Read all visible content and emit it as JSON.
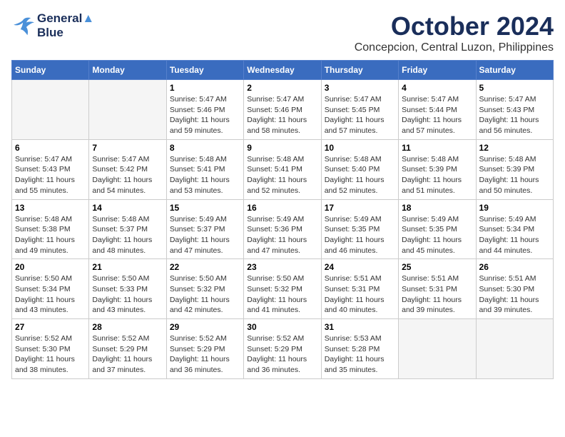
{
  "logo": {
    "line1": "General",
    "line2": "Blue"
  },
  "title": "October 2024",
  "location": "Concepcion, Central Luzon, Philippines",
  "weekdays": [
    "Sunday",
    "Monday",
    "Tuesday",
    "Wednesday",
    "Thursday",
    "Friday",
    "Saturday"
  ],
  "weeks": [
    [
      {
        "day": "",
        "info": ""
      },
      {
        "day": "",
        "info": ""
      },
      {
        "day": "1",
        "sunrise": "5:47 AM",
        "sunset": "5:46 PM",
        "daylight": "11 hours and 59 minutes."
      },
      {
        "day": "2",
        "sunrise": "5:47 AM",
        "sunset": "5:46 PM",
        "daylight": "11 hours and 58 minutes."
      },
      {
        "day": "3",
        "sunrise": "5:47 AM",
        "sunset": "5:45 PM",
        "daylight": "11 hours and 57 minutes."
      },
      {
        "day": "4",
        "sunrise": "5:47 AM",
        "sunset": "5:44 PM",
        "daylight": "11 hours and 57 minutes."
      },
      {
        "day": "5",
        "sunrise": "5:47 AM",
        "sunset": "5:43 PM",
        "daylight": "11 hours and 56 minutes."
      }
    ],
    [
      {
        "day": "6",
        "sunrise": "5:47 AM",
        "sunset": "5:43 PM",
        "daylight": "11 hours and 55 minutes."
      },
      {
        "day": "7",
        "sunrise": "5:47 AM",
        "sunset": "5:42 PM",
        "daylight": "11 hours and 54 minutes."
      },
      {
        "day": "8",
        "sunrise": "5:48 AM",
        "sunset": "5:41 PM",
        "daylight": "11 hours and 53 minutes."
      },
      {
        "day": "9",
        "sunrise": "5:48 AM",
        "sunset": "5:41 PM",
        "daylight": "11 hours and 52 minutes."
      },
      {
        "day": "10",
        "sunrise": "5:48 AM",
        "sunset": "5:40 PM",
        "daylight": "11 hours and 52 minutes."
      },
      {
        "day": "11",
        "sunrise": "5:48 AM",
        "sunset": "5:39 PM",
        "daylight": "11 hours and 51 minutes."
      },
      {
        "day": "12",
        "sunrise": "5:48 AM",
        "sunset": "5:39 PM",
        "daylight": "11 hours and 50 minutes."
      }
    ],
    [
      {
        "day": "13",
        "sunrise": "5:48 AM",
        "sunset": "5:38 PM",
        "daylight": "11 hours and 49 minutes."
      },
      {
        "day": "14",
        "sunrise": "5:48 AM",
        "sunset": "5:37 PM",
        "daylight": "11 hours and 48 minutes."
      },
      {
        "day": "15",
        "sunrise": "5:49 AM",
        "sunset": "5:37 PM",
        "daylight": "11 hours and 47 minutes."
      },
      {
        "day": "16",
        "sunrise": "5:49 AM",
        "sunset": "5:36 PM",
        "daylight": "11 hours and 47 minutes."
      },
      {
        "day": "17",
        "sunrise": "5:49 AM",
        "sunset": "5:35 PM",
        "daylight": "11 hours and 46 minutes."
      },
      {
        "day": "18",
        "sunrise": "5:49 AM",
        "sunset": "5:35 PM",
        "daylight": "11 hours and 45 minutes."
      },
      {
        "day": "19",
        "sunrise": "5:49 AM",
        "sunset": "5:34 PM",
        "daylight": "11 hours and 44 minutes."
      }
    ],
    [
      {
        "day": "20",
        "sunrise": "5:50 AM",
        "sunset": "5:34 PM",
        "daylight": "11 hours and 43 minutes."
      },
      {
        "day": "21",
        "sunrise": "5:50 AM",
        "sunset": "5:33 PM",
        "daylight": "11 hours and 43 minutes."
      },
      {
        "day": "22",
        "sunrise": "5:50 AM",
        "sunset": "5:32 PM",
        "daylight": "11 hours and 42 minutes."
      },
      {
        "day": "23",
        "sunrise": "5:50 AM",
        "sunset": "5:32 PM",
        "daylight": "11 hours and 41 minutes."
      },
      {
        "day": "24",
        "sunrise": "5:51 AM",
        "sunset": "5:31 PM",
        "daylight": "11 hours and 40 minutes."
      },
      {
        "day": "25",
        "sunrise": "5:51 AM",
        "sunset": "5:31 PM",
        "daylight": "11 hours and 39 minutes."
      },
      {
        "day": "26",
        "sunrise": "5:51 AM",
        "sunset": "5:30 PM",
        "daylight": "11 hours and 39 minutes."
      }
    ],
    [
      {
        "day": "27",
        "sunrise": "5:52 AM",
        "sunset": "5:30 PM",
        "daylight": "11 hours and 38 minutes."
      },
      {
        "day": "28",
        "sunrise": "5:52 AM",
        "sunset": "5:29 PM",
        "daylight": "11 hours and 37 minutes."
      },
      {
        "day": "29",
        "sunrise": "5:52 AM",
        "sunset": "5:29 PM",
        "daylight": "11 hours and 36 minutes."
      },
      {
        "day": "30",
        "sunrise": "5:52 AM",
        "sunset": "5:29 PM",
        "daylight": "11 hours and 36 minutes."
      },
      {
        "day": "31",
        "sunrise": "5:53 AM",
        "sunset": "5:28 PM",
        "daylight": "11 hours and 35 minutes."
      },
      {
        "day": "",
        "info": ""
      },
      {
        "day": "",
        "info": ""
      }
    ]
  ]
}
